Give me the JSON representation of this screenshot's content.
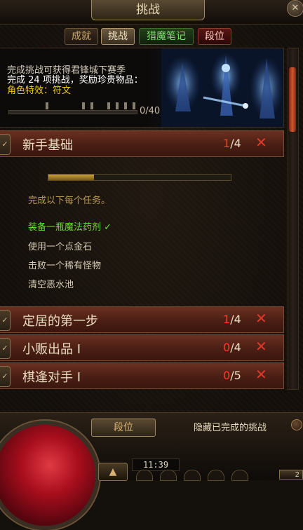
{
  "window": {
    "title": "挑战",
    "close_icon": "close-icon"
  },
  "tabs": [
    {
      "label": "成就",
      "active": false
    },
    {
      "label": "挑战",
      "active": true
    },
    {
      "label": "猎魔笔记",
      "active": false
    },
    {
      "label": "段位",
      "active": false
    }
  ],
  "banner": {
    "line1": "完成挑战可获得君锋城下赛季",
    "line2": "完成 24 项挑战，奖励珍贵物品：",
    "line3": "角色特效：符文",
    "progress_text": "0/40",
    "progress_fraction": 0,
    "colors": {
      "line1": "#d8d0c0",
      "line2": "#ffffff",
      "line3": "#f0d000"
    }
  },
  "sections": [
    {
      "title": "新手基础",
      "done": "1",
      "total": "/4",
      "expanded": true
    },
    {
      "title": "定居的第一步",
      "done": "1",
      "total": "/4",
      "expanded": false
    },
    {
      "title": "小贩出品 I",
      "done": "0",
      "total": "/4",
      "expanded": false
    },
    {
      "title": "棋逢对手 I",
      "done": "0",
      "total": "/5",
      "expanded": false
    }
  ],
  "expanded_section": {
    "progress_fraction": 0.25,
    "intro": "完成以下每个任务。",
    "tasks": [
      {
        "label": "装备一瓶魔法药剂",
        "completed": true,
        "check": "✓"
      },
      {
        "label": "使用一个点金石",
        "completed": false
      },
      {
        "label": "击败一个稀有怪物",
        "completed": false
      },
      {
        "label": "清空恶水池",
        "completed": false
      }
    ]
  },
  "bottom": {
    "rank_button": "段位",
    "hide_completed_label": "隐藏已完成的挑战",
    "clock": "11:39"
  },
  "colors": {
    "accent_red": "#e23a2a",
    "complete_green": "#6edc3c",
    "gold": "#f0d000"
  }
}
